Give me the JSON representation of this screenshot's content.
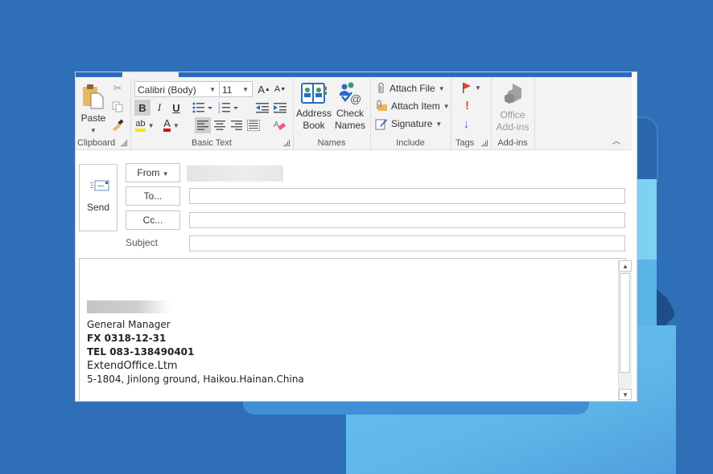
{
  "ribbon": {
    "clipboard": {
      "label": "Clipboard",
      "paste_label": "Paste"
    },
    "basic_text": {
      "label": "Basic Text",
      "font_name": "Calibri (Body)",
      "font_size": "11",
      "bold": "B",
      "italic": "I",
      "underline": "U",
      "grow_font": "A",
      "shrink_font": "A",
      "font_color": "A",
      "highlight": "ab"
    },
    "names": {
      "label": "Names",
      "address_book_line1": "Address",
      "address_book_line2": "Book",
      "check_names_line1": "Check",
      "check_names_line2": "Names"
    },
    "include": {
      "label": "Include",
      "attach_file": "Attach File",
      "attach_item": "Attach Item",
      "signature": "Signature"
    },
    "tags": {
      "label": "Tags",
      "importance_high": "!",
      "importance_low": "↓"
    },
    "addins": {
      "label": "Add-ins",
      "office_addins_line1": "Office",
      "office_addins_line2": "Add-ins"
    }
  },
  "compose": {
    "send_label": "Send",
    "from_label": "From",
    "to_label": "To...",
    "cc_label": "Cc...",
    "subject_label": "Subject",
    "to_value": "",
    "cc_value": "",
    "subject_value": ""
  },
  "signature": {
    "title": "General Manager",
    "fax": "FX 0318-12-31",
    "tel": "TEL 083-138490401",
    "company": "ExtendOffice.Ltm",
    "address": "5-1804, Jinlong ground, Haikou.Hainan.China"
  },
  "colors": {
    "background": "#2f6fb8",
    "title_strip": "#2b6cc0",
    "ribbon": "#f3f3f3",
    "highlight_yellow": "#f5e900",
    "font_red": "#e00000",
    "flag_red": "#d9462b"
  }
}
